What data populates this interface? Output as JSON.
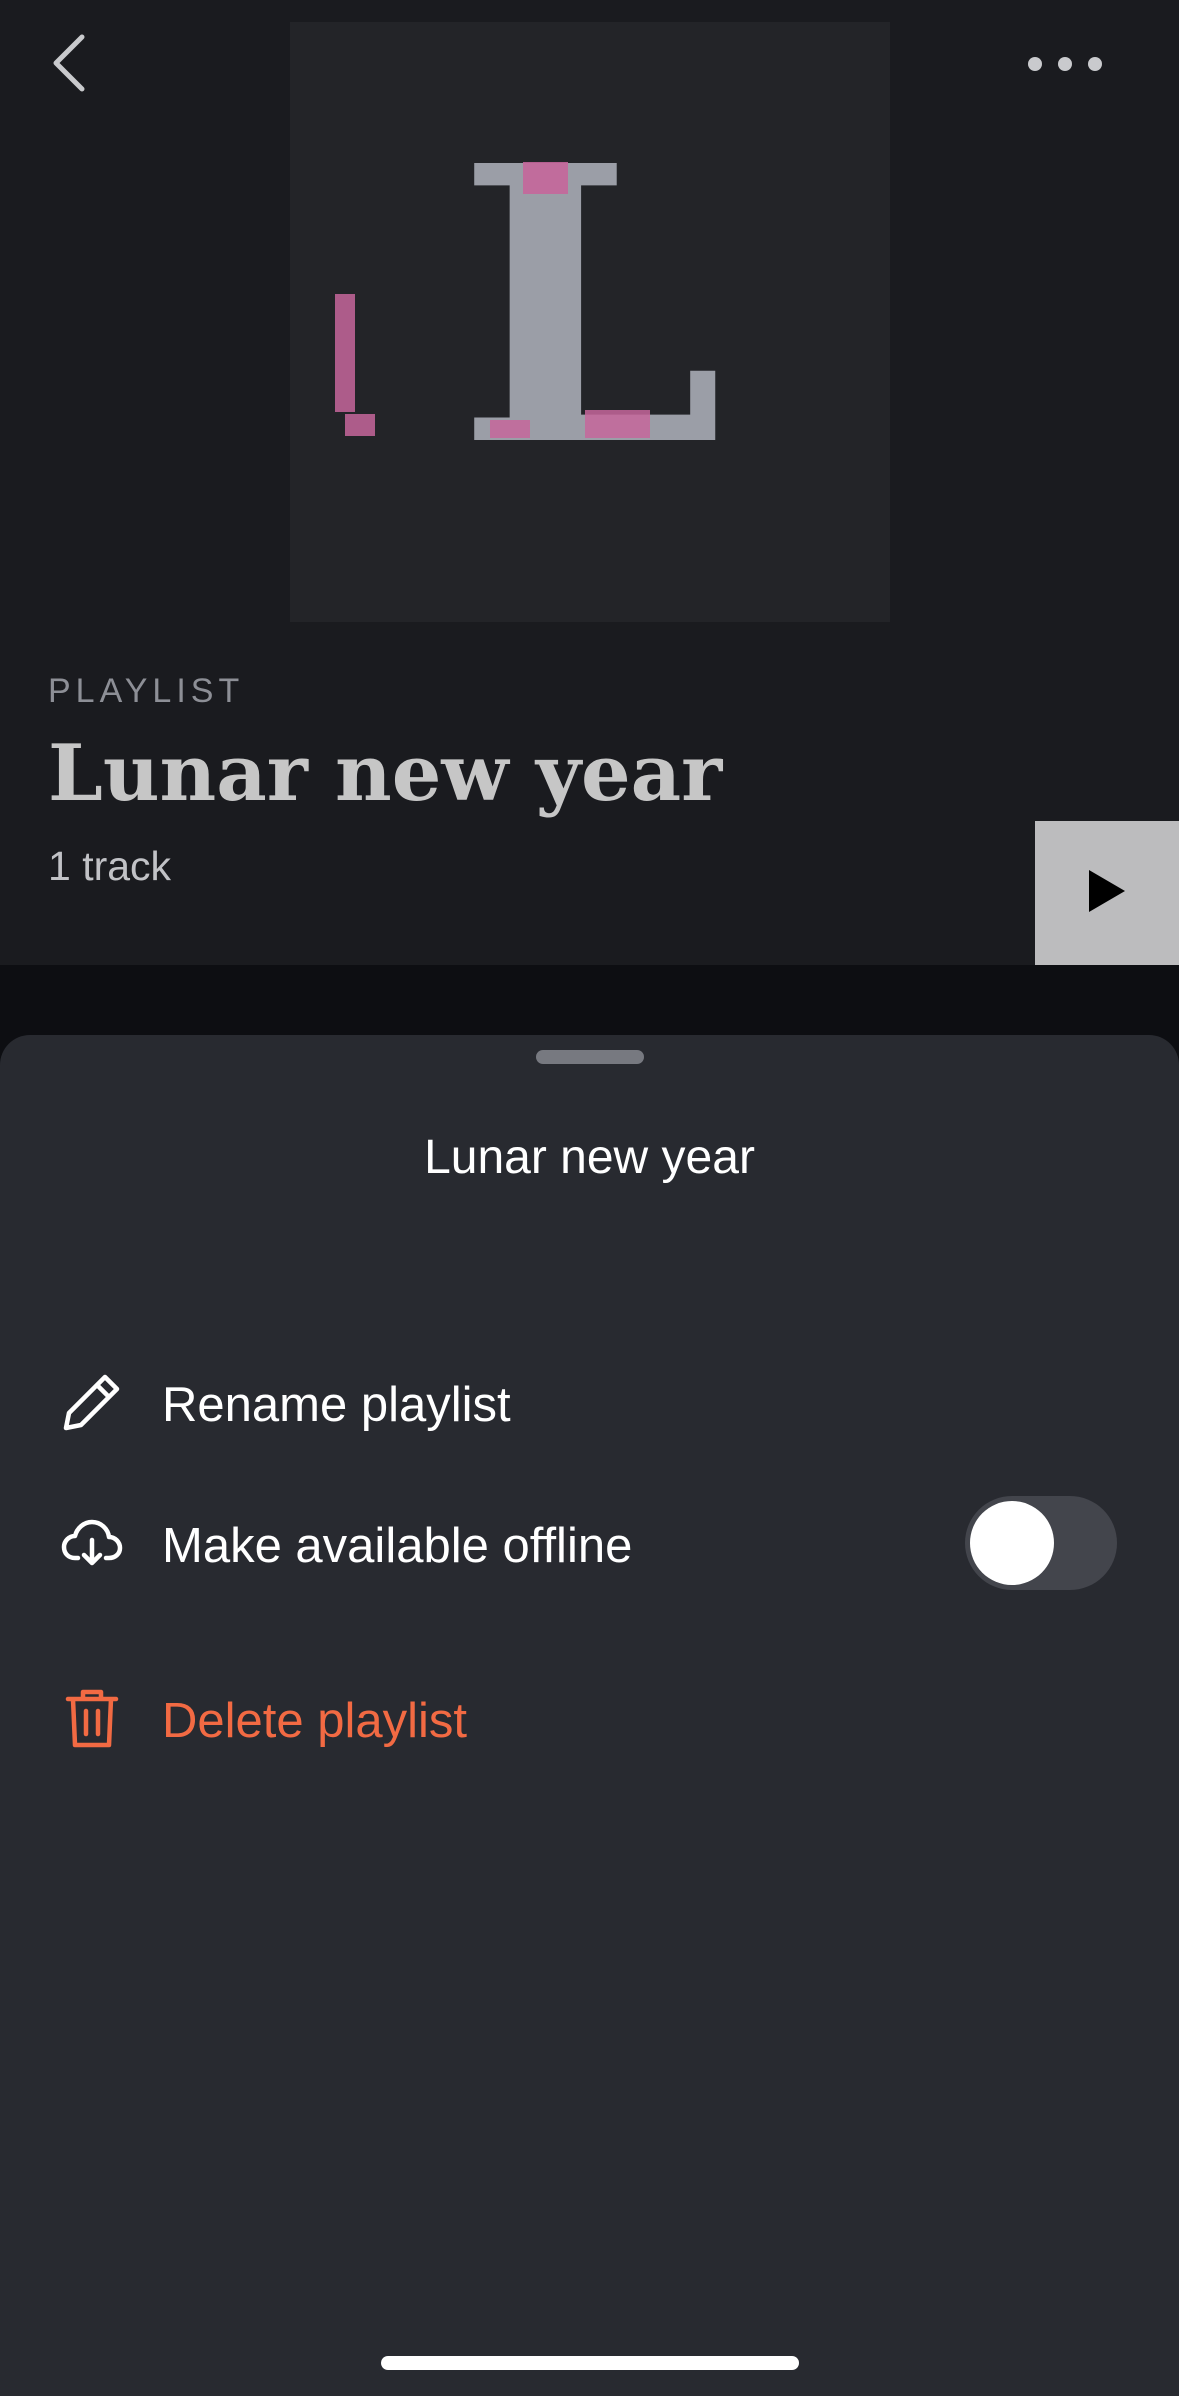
{
  "header": {
    "back_icon": "chevron-left-icon",
    "more_icon": "ellipsis-icon",
    "cover_letter": "L",
    "eyebrow": "PLAYLIST",
    "title": "Lunar new year",
    "track_count": "1 track",
    "play_icon": "play-icon"
  },
  "sheet": {
    "title": "Lunar new year",
    "items": [
      {
        "label": "Rename playlist",
        "icon": "pencil-icon"
      },
      {
        "label": "Make available offline",
        "icon": "cloud-download-icon",
        "toggle_on": false
      },
      {
        "label": "Delete playlist",
        "icon": "trash-icon"
      }
    ]
  },
  "colors": {
    "accent_danger": "#f26a43",
    "sheet_background": "#282a30",
    "header_background": "#1a1b1f",
    "cover_pink": "#c5669b",
    "cover_gray": "#9b9ea7"
  }
}
